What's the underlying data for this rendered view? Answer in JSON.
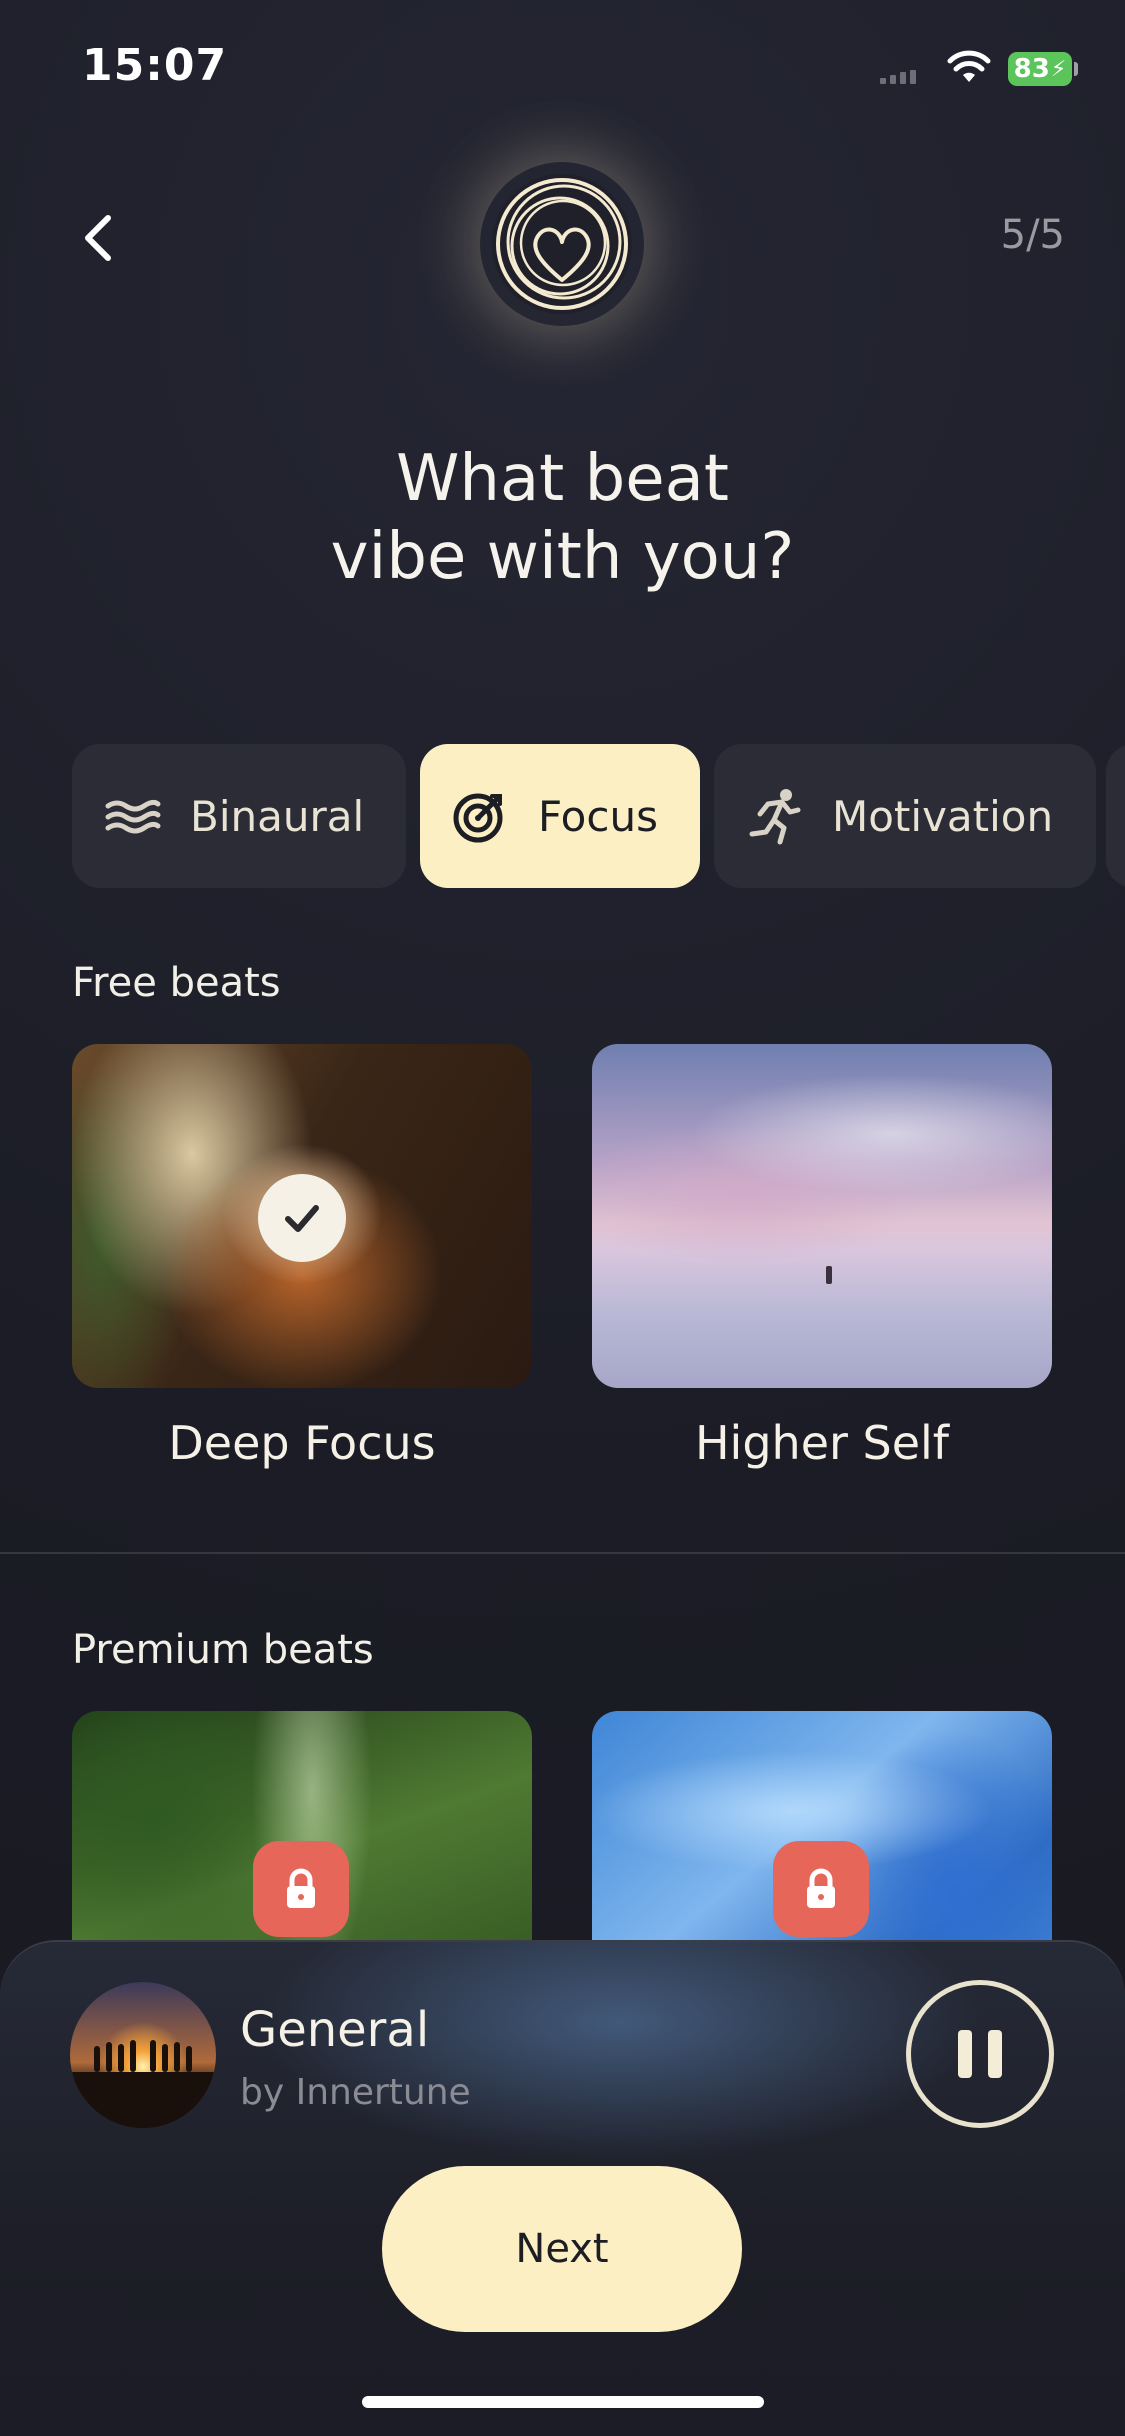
{
  "status_bar": {
    "time": "15:07",
    "battery": "83"
  },
  "header": {
    "step": "5/5",
    "back_icon": "chevron-left-icon",
    "logo_icon": "heart-scribble-logo"
  },
  "title_lines": [
    "What beat",
    "vibe with you?"
  ],
  "categories": [
    {
      "label": "Binaural",
      "icon": "waves-icon",
      "selected": false
    },
    {
      "label": "Focus",
      "icon": "target-icon",
      "selected": true
    },
    {
      "label": "Motivation",
      "icon": "running-icon",
      "selected": false
    }
  ],
  "free_section": {
    "title": "Free beats",
    "items": [
      {
        "label": "Deep Focus",
        "selected": true
      },
      {
        "label": "Higher Self",
        "selected": false
      }
    ]
  },
  "premium_section": {
    "title": "Premium beats",
    "items": [
      {
        "label": "",
        "locked": true
      },
      {
        "label": "",
        "locked": true
      }
    ]
  },
  "player": {
    "title": "General",
    "subtitle": "by Innertune",
    "state": "playing"
  },
  "next_label": "Next",
  "colors": {
    "background": "#1b1c25",
    "accent": "#fcefc4",
    "lock": "#e6665a"
  }
}
